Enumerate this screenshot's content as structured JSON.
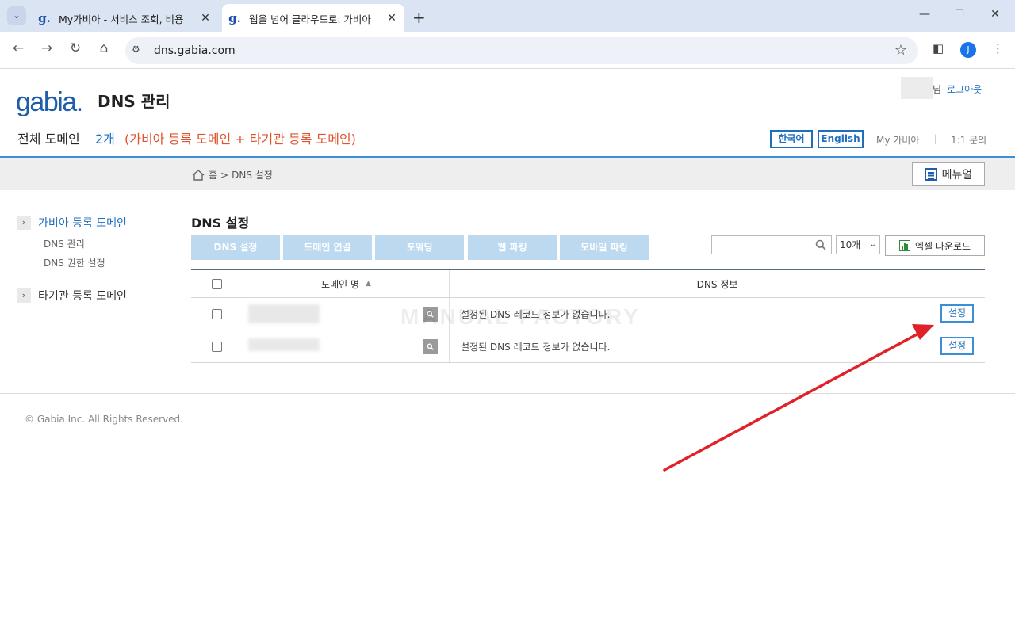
{
  "browser": {
    "tabs": [
      {
        "title": "My가비아 - 서비스 조회, 비용",
        "favicon": "g."
      },
      {
        "title": "웹을 넘어 클라우드로. 가비아",
        "favicon": "g."
      }
    ],
    "url": "dns.gabia.com",
    "profile_initial": "J"
  },
  "header": {
    "logo": "gabia.",
    "app_title": "DNS 관리",
    "user_suffix": "님",
    "logout": "로그아웃",
    "total_label": "전체 도메인",
    "total_count": "2개",
    "total_note": "(가비아 등록 도메인 + 타기관 등록 도메인)",
    "lang_ko": "한국어",
    "lang_en": "English",
    "my_gabia": "My 가비아",
    "separator": "|",
    "inquiry": "1:1 문의"
  },
  "breadcrumb": {
    "home": "홈",
    "arrow": ">",
    "current": "DNS 설정",
    "manual": "메뉴얼"
  },
  "sidebar": {
    "gabia_group": "가비아 등록 도메인",
    "gabia_items": [
      "DNS 관리",
      "DNS 권한 설정"
    ],
    "other_group": "타기관 등록 도메인"
  },
  "main": {
    "title": "DNS 설정",
    "actions": [
      "DNS 설정",
      "도메인 연결",
      "포워딩",
      "웹 파킹",
      "모바일 파킹"
    ],
    "page_size": "10개",
    "excel": "엑셀 다운로드",
    "columns": {
      "domain": "도메인 명",
      "sort": "▲",
      "dns": "DNS 정보"
    },
    "rows": [
      {
        "dns_info": "설정된 DNS 레코드 정보가 없습니다.",
        "action": "설정"
      },
      {
        "dns_info": "설정된 DNS 레코드 정보가 없습니다.",
        "action": "설정"
      }
    ],
    "watermark": "MANUAL FACTORY"
  },
  "footer": {
    "copyright": "© Gabia Inc. All Rights Reserved."
  },
  "colors": {
    "brand": "#1f5ea8",
    "link": "#1f6fbf",
    "note": "#e0532d",
    "action_button": "#bcd9f0",
    "arrow": "#e0212a"
  },
  "icons": [
    "home-icon",
    "search-icon",
    "manual-icon",
    "excel-icon",
    "zoom-icon",
    "star-icon",
    "sidebar-arrow-icon"
  ]
}
